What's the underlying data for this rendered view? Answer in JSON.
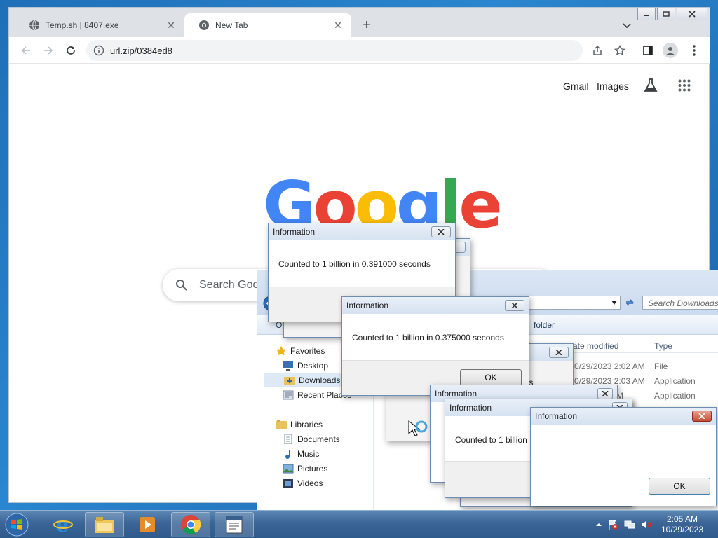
{
  "browser": {
    "tabs": [
      {
        "title": "Temp.sh | 8407.exe",
        "active": false
      },
      {
        "title": "New Tab",
        "active": true
      }
    ],
    "url": "url.zip/0384ed8",
    "ntp": {
      "links": [
        "Gmail",
        "Images"
      ],
      "logo_letters": [
        {
          "ch": "G",
          "color": "#4285f4"
        },
        {
          "ch": "o",
          "color": "#ea4335"
        },
        {
          "ch": "o",
          "color": "#fbbc05"
        },
        {
          "ch": "g",
          "color": "#4285f4"
        },
        {
          "ch": "l",
          "color": "#34a853"
        },
        {
          "ch": "e",
          "color": "#ea4335"
        }
      ],
      "search_placeholder": "Search Goo"
    }
  },
  "explorer": {
    "search_placeholder": "Search Downloads",
    "cmdbar": {
      "left": "Or",
      "right": "folder"
    },
    "nav": {
      "favorites": "Favorites",
      "favorites_items": [
        "Desktop",
        "Downloads",
        "Recent Places"
      ],
      "libraries": "Libraries",
      "libraries_items": [
        "Documents",
        "Music",
        "Pictures",
        "Videos"
      ]
    },
    "columns": {
      "date": "ate modified",
      "type": "Type"
    },
    "files": [
      {
        "date": "0/29/2023 2:02 AM",
        "type": "File"
      },
      {
        "date": "0/29/2023 2:03 AM",
        "type": "Application"
      },
      {
        "date": "57 AM",
        "type": "Application"
      }
    ],
    "partial_text": "nds"
  },
  "dialogs": [
    {
      "title": "Information",
      "message": "Counted to 1 billion in 0.391000 seconds"
    },
    {
      "title": "Information",
      "message": "Counted to 1 billion in 0.375000 seconds",
      "ok": "OK"
    },
    {
      "title": "Information"
    },
    {
      "title": "Information",
      "message": "Counted to 1 billion"
    },
    {
      "title": "Information",
      "ok": "OK"
    }
  ],
  "ghost_text": "C",
  "taskbar": {
    "time": "2:05 AM",
    "date": "10/29/2023"
  },
  "colors": {
    "chrome_tabstrip": "#dee1e6",
    "taskbar": "#3b6597",
    "dialog_caption": "#d6e2f1"
  }
}
